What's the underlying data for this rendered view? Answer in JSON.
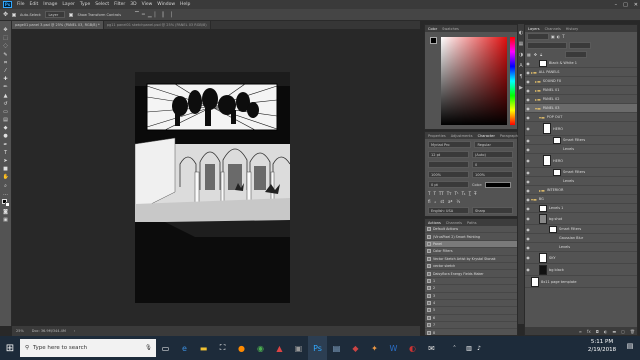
{
  "app": {
    "logo": "Ps",
    "menu": [
      "File",
      "Edit",
      "Image",
      "Layer",
      "Type",
      "Select",
      "Filter",
      "3D",
      "View",
      "Window",
      "Help"
    ],
    "window_controls": [
      "minimize-icon",
      "maximize-icon",
      "close-icon"
    ]
  },
  "options_bar": {
    "auto_select": "Auto-Select:",
    "layer_dropdown": "Layer",
    "show_transform": "Show Transform Controls"
  },
  "tabs": [
    {
      "label": "page01 panel 3.psd @ 25% (PANEL 03, RGB/8) *",
      "active": true
    },
    {
      "label": "pg11 panel01 sketchpanel.psd @ 25% (PANEL 03 RGB/8)",
      "active": false
    }
  ],
  "status_bar": {
    "zoom": "25%",
    "doc": "Doc: 36.9M/344.4M"
  },
  "color_panel": {
    "tabs": [
      "Color",
      "Swatches"
    ]
  },
  "character_panel": {
    "tabs": [
      "Properties",
      "Adjustments",
      "Character",
      "Paragraph"
    ],
    "font": "Myriad Pro",
    "style": "Regular",
    "size": "12 pt",
    "leading": "(Auto)",
    "tracking": "0",
    "vscale": "100%",
    "hscale": "100%",
    "baseline": "0 pt",
    "color_label": "Color:",
    "language": "English: USA",
    "aa": "Sharp"
  },
  "history_panel": {
    "tabs": [
      "Actions",
      "Channels",
      "Paths"
    ],
    "items": [
      "Default Actions",
      "(VirusPixel 2) Smart Painting",
      "Panel",
      "Color Filters",
      "Vector Sketch Artist by Krystal Stonak",
      "vector sketch",
      "Daisyflora Energy Fields Maker",
      "1",
      "2",
      "3",
      "4",
      "5",
      "6",
      "7",
      "8",
      "9",
      "10"
    ]
  },
  "layers_panel": {
    "tabs": [
      "Layers",
      "Channels",
      "History"
    ],
    "layers": [
      {
        "name": "Black & White 1",
        "type": "adj"
      },
      {
        "name": "ALL PANELS",
        "type": "folder"
      },
      {
        "name": "SOUND FX",
        "type": "folder"
      },
      {
        "name": "PANEL 01",
        "type": "folder"
      },
      {
        "name": "PANEL 02",
        "type": "folder"
      },
      {
        "name": "PANEL 03",
        "type": "folder"
      },
      {
        "name": "POP OUT",
        "type": "folder"
      },
      {
        "name": "HERO",
        "type": "layer"
      },
      {
        "name": "Smart Filters",
        "type": "sub"
      },
      {
        "name": "Levels",
        "type": "sub"
      },
      {
        "name": "HERO",
        "type": "layer"
      },
      {
        "name": "Smart Filters",
        "type": "sub"
      },
      {
        "name": "Levels",
        "type": "sub"
      },
      {
        "name": "INTERIOR",
        "type": "folder"
      },
      {
        "name": "BG",
        "type": "folder"
      },
      {
        "name": "Levels 1",
        "type": "adj"
      },
      {
        "name": "bg shot",
        "type": "layer"
      },
      {
        "name": "Smart Filters",
        "type": "sub"
      },
      {
        "name": "Gaussian Blur",
        "type": "sub"
      },
      {
        "name": "Levels",
        "type": "sub"
      },
      {
        "name": "SKY",
        "type": "layer"
      },
      {
        "name": "bg black",
        "type": "layer"
      },
      {
        "name": "8x11 page template",
        "type": "layer"
      }
    ]
  },
  "taskbar": {
    "search_placeholder": "Type here to search",
    "time": "5:11 PM",
    "date": "2/19/2018"
  }
}
